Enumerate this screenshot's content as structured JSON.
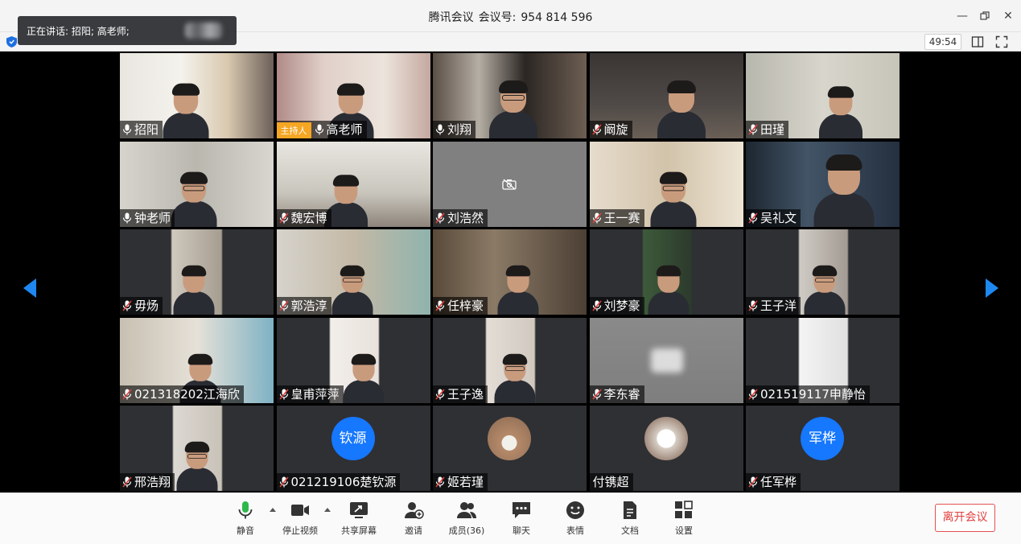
{
  "window": {
    "app_name": "腾讯会议",
    "meeting_id_label": "会议号:",
    "meeting_id": "954 814 596"
  },
  "toast": {
    "text": "正在讲话: 招阳; 高老师;"
  },
  "timer": "49:54",
  "host_badge": "主持人",
  "participants": [
    {
      "name": "招阳",
      "mic": "on"
    },
    {
      "name": "高老师",
      "mic": "on",
      "host": true
    },
    {
      "name": "刘翔",
      "mic": "on"
    },
    {
      "name": "阚旋",
      "mic": "muted"
    },
    {
      "name": "田瑾",
      "mic": "muted"
    },
    {
      "name": "钟老师",
      "mic": "on"
    },
    {
      "name": "魏宏博",
      "mic": "muted"
    },
    {
      "name": "刘浩然",
      "mic": "muted",
      "camera": "off"
    },
    {
      "name": "王一赛",
      "mic": "muted"
    },
    {
      "name": "吴礼文",
      "mic": "muted"
    },
    {
      "name": "毋炀",
      "mic": "muted"
    },
    {
      "name": "郭浩淳",
      "mic": "muted"
    },
    {
      "name": "任梓豪",
      "mic": "muted"
    },
    {
      "name": "刘梦豪",
      "mic": "muted"
    },
    {
      "name": "王子洋",
      "mic": "muted"
    },
    {
      "name": "021318202江海欣",
      "mic": "muted"
    },
    {
      "name": "皇甫萍萍",
      "mic": "muted"
    },
    {
      "name": "王子逸",
      "mic": "muted"
    },
    {
      "name": "李东睿",
      "mic": "muted"
    },
    {
      "name": "021519117申静怡",
      "mic": "muted"
    },
    {
      "name": "邢浩翔",
      "mic": "muted"
    },
    {
      "name": "021219106楚钦源",
      "mic": "muted",
      "avatar_text": "钦源"
    },
    {
      "name": "姬若瑾",
      "mic": "muted",
      "avatar_image": "rooster-photo"
    },
    {
      "name": "付镌超",
      "mic": "none",
      "avatar_image": "cartoon-avatar"
    },
    {
      "name": "任军桦",
      "mic": "muted",
      "avatar_text": "军桦"
    }
  ],
  "toolbar": {
    "mute": "静音",
    "stop_video": "停止视频",
    "share_screen": "共享屏幕",
    "invite": "邀请",
    "members": "成员(36)",
    "chat": "聊天",
    "reactions": "表情",
    "docs": "文档",
    "settings": "设置",
    "leave": "离开会议"
  },
  "colors": {
    "accent": "#1e88f0",
    "host_badge": "#f5a623",
    "leave": "#e0403f",
    "muted_mic": "#e0403f"
  }
}
